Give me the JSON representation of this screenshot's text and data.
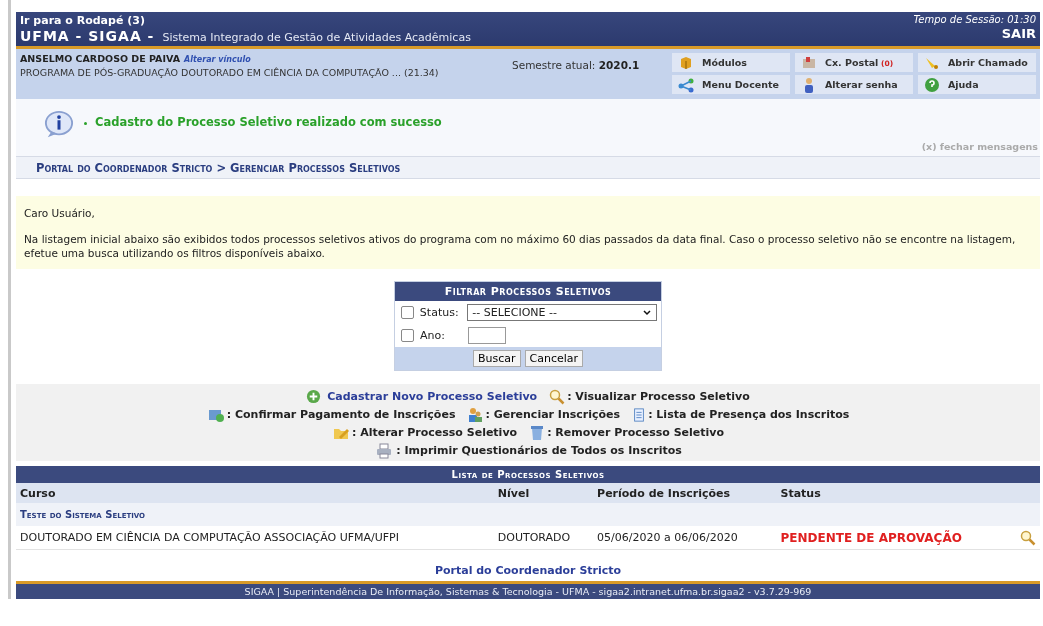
{
  "header": {
    "skip_link": "Ir para o Rodapé (3)",
    "system": "UFMA - SIGAA -",
    "subtitle": "Sistema Integrado de Gestão de Atividades Acadêmicas",
    "session": "Tempo de Sessão: 01:30",
    "logout": "SAIR"
  },
  "user": {
    "name": "ANSELMO CARDOSO DE PAIVA",
    "change_link": "Alterar vínculo",
    "program": "PROGRAMA DE PÓS-GRADUAÇÃO DOUTORADO EM CIÊNCIA DA COMPUTAÇÃO ... (21.34)",
    "semester_label": "Semestre atual:",
    "semester": "2020.1"
  },
  "menu": [
    {
      "label": "Módulos",
      "kind": "modules"
    },
    {
      "label": "Cx. Postal",
      "badge": "(0)",
      "kind": "mail"
    },
    {
      "label": "Abrir Chamado",
      "kind": "ticket"
    },
    {
      "label": "Menu Docente",
      "kind": "teacher"
    },
    {
      "label": "Alterar senha",
      "kind": "password"
    },
    {
      "label": "Ajuda",
      "kind": "help"
    }
  ],
  "message": {
    "text": "Cadastro do Processo Seletivo realizado com sucesso",
    "close": "(x) fechar mensagens"
  },
  "breadcrumb": "Portal do Coordenador Stricto > Gerenciar Processos Seletivos",
  "notice": {
    "greeting": "Caro Usuário,",
    "text": "Na listagem inicial abaixo são exibidos todos processos seletivos ativos do programa com no máximo 60 dias passados da data final. Caso o processo seletivo não se encontre na listagem, efetue uma busca utilizando os filtros disponíveis abaixo."
  },
  "filter": {
    "title": "Filtrar Processos Seletivos",
    "fields": [
      {
        "label": "Status:",
        "kind": "select",
        "value": "-- SELECIONE --",
        "checked": false
      },
      {
        "label": "Ano:",
        "kind": "text",
        "checked": false
      }
    ],
    "buttons": [
      "Buscar",
      "Cancelar"
    ]
  },
  "legend": [
    [
      {
        "kind": "add",
        "label": "Cadastrar Novo Processo Seletivo"
      },
      {
        "kind": "view",
        "label": ": Visualizar Processo Seletivo"
      }
    ],
    [
      {
        "kind": "payment",
        "label": ": Confirmar Pagamento de Inscrições"
      },
      {
        "kind": "manage",
        "label": ": Gerenciar Inscrições"
      },
      {
        "kind": "attendance",
        "label": ": Lista de Presença dos Inscritos"
      }
    ],
    [
      {
        "kind": "edit",
        "label": ": Alterar Processo Seletivo"
      },
      {
        "kind": "remove",
        "label": ": Remover Processo Seletivo"
      }
    ],
    [
      {
        "kind": "print",
        "label": ": Imprimir Questionários de Todos os Inscritos"
      }
    ]
  ],
  "table": {
    "title": "Lista de Processos Seletivos",
    "columns": [
      "Curso",
      "Nível",
      "Período de Inscrições",
      "Status"
    ],
    "groups": [
      {
        "name": "Teste do Sistema Seletivo",
        "rows": [
          {
            "cells": [
              "DOUTORADO EM CIÊNCIA DA COMPUTAÇÃO ASSOCIAÇÃO UFMA/UFPI",
              "DOUTORADO",
              "05/06/2020 a 06/06/2020",
              "PENDENTE DE APROVAÇÃO"
            ]
          }
        ]
      }
    ]
  },
  "footer": {
    "link": "Portal do Coordenador Stricto",
    "text": "SIGAA | Superintendência De Informação, Sistemas & Tecnologia - UFMA - sigaa2.intranet.ufma.br.sigaa2 - v3.7.29-969"
  }
}
